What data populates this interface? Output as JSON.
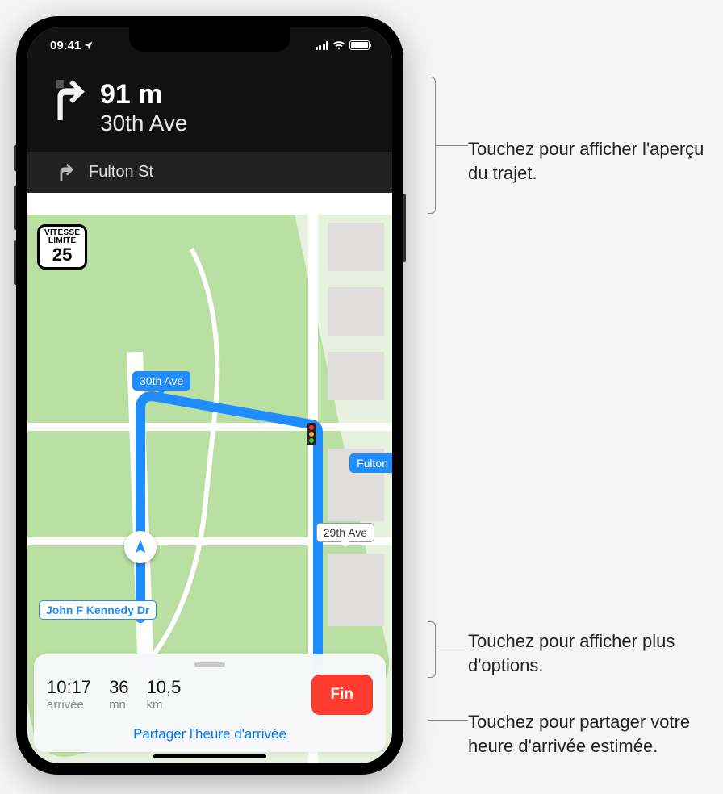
{
  "status": {
    "time": "09:41"
  },
  "nav": {
    "distance": "91 m",
    "primary_street": "30th Ave",
    "secondary_street": "Fulton St"
  },
  "speed_limit": {
    "label1": "VITESSE",
    "label2": "LIMITE",
    "value": "25"
  },
  "map_labels": {
    "route_primary": "30th Ave",
    "route_secondary": "Fulton",
    "cross_street": "29th Ave",
    "main_road": "John F Kennedy Dr"
  },
  "drawer": {
    "arrival_time": "10:17",
    "arrival_label": "arrivée",
    "duration_value": "36",
    "duration_unit": "mn",
    "distance_value": "10,5",
    "distance_unit": "km",
    "end_button": "Fin",
    "share_eta": "Partager l'heure d'arrivée"
  },
  "annotations": {
    "a1": "Touchez pour afficher l'aperçu du trajet.",
    "a2": "Touchez pour afficher plus d'options.",
    "a3": "Touchez pour partager votre heure d'arrivée estimée."
  }
}
